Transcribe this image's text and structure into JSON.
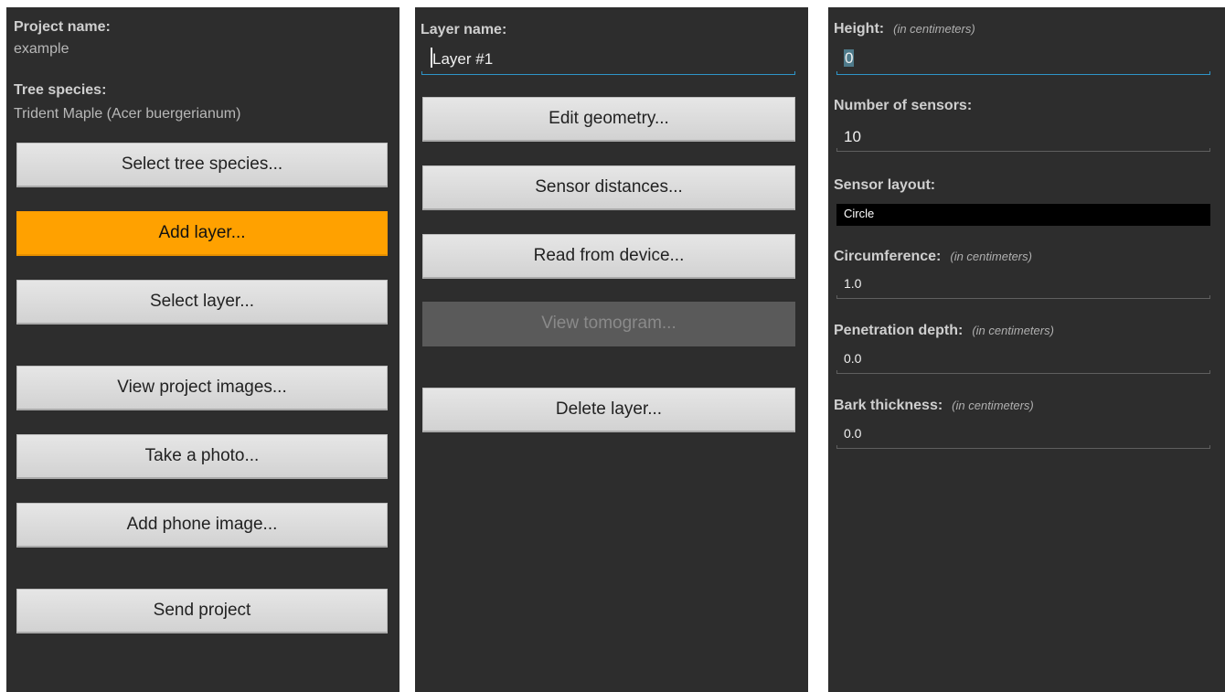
{
  "project_panel": {
    "project_name_label": "Project name:",
    "project_name_value": "example",
    "tree_species_label": "Tree species:",
    "tree_species_value": "Trident Maple (Acer buergerianum)",
    "buttons": {
      "select_tree_species": "Select tree species...",
      "add_layer": "Add layer...",
      "select_layer": "Select layer...",
      "view_project_images": "View project images...",
      "take_photo": "Take a photo...",
      "add_phone_image": "Add phone image...",
      "send_project": "Send project"
    },
    "accent_color": "#ffa100"
  },
  "layer_panel": {
    "layer_name_label": "Layer name:",
    "layer_name_value": "Layer #1",
    "buttons": {
      "edit_geometry": "Edit geometry...",
      "sensor_distances": "Sensor distances...",
      "read_from_device": "Read from device...",
      "view_tomogram": "View tomogram...",
      "delete_layer": "Delete layer..."
    },
    "view_tomogram_enabled": false,
    "focus_color": "#2e95c8"
  },
  "geometry_panel": {
    "height_label": "Height:",
    "height_hint": "(in centimeters)",
    "height_value": "0",
    "num_sensors_label": "Number of sensors:",
    "num_sensors_value": "10",
    "sensor_layout_label": "Sensor layout:",
    "sensor_layout_value": "Circle",
    "circumference_label": "Circumference:",
    "circumference_hint": "(in centimeters)",
    "circumference_value": "1.0",
    "penetration_label": "Penetration depth:",
    "penetration_hint": "(in centimeters)",
    "penetration_value": "0.0",
    "bark_label": "Bark thickness:",
    "bark_hint": "(in centimeters)",
    "bark_value": "0.0"
  }
}
